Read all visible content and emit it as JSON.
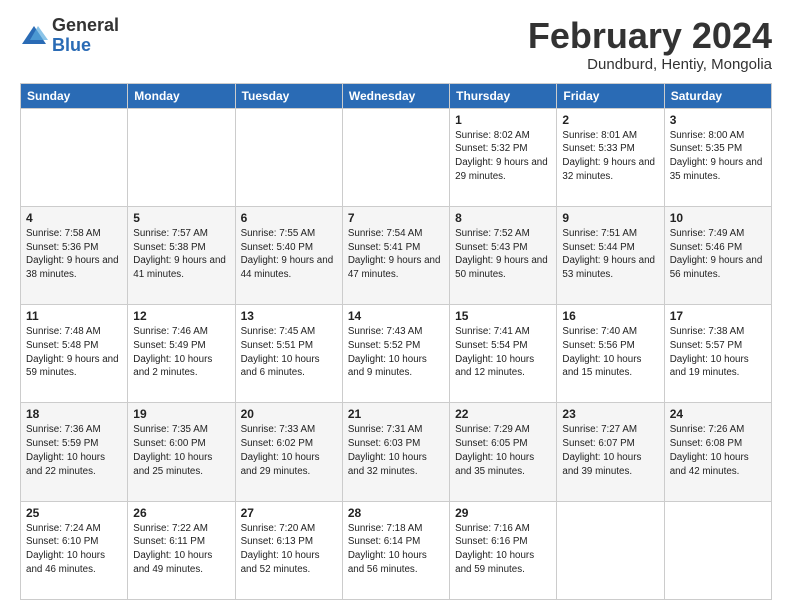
{
  "logo": {
    "general": "General",
    "blue": "Blue"
  },
  "title": "February 2024",
  "location": "Dundburd, Hentiy, Mongolia",
  "weekdays": [
    "Sunday",
    "Monday",
    "Tuesday",
    "Wednesday",
    "Thursday",
    "Friday",
    "Saturday"
  ],
  "weeks": [
    [
      {
        "day": "",
        "sunrise": "",
        "sunset": "",
        "daylight": ""
      },
      {
        "day": "",
        "sunrise": "",
        "sunset": "",
        "daylight": ""
      },
      {
        "day": "",
        "sunrise": "",
        "sunset": "",
        "daylight": ""
      },
      {
        "day": "",
        "sunrise": "",
        "sunset": "",
        "daylight": ""
      },
      {
        "day": "1",
        "sunrise": "Sunrise: 8:02 AM",
        "sunset": "Sunset: 5:32 PM",
        "daylight": "Daylight: 9 hours and 29 minutes."
      },
      {
        "day": "2",
        "sunrise": "Sunrise: 8:01 AM",
        "sunset": "Sunset: 5:33 PM",
        "daylight": "Daylight: 9 hours and 32 minutes."
      },
      {
        "day": "3",
        "sunrise": "Sunrise: 8:00 AM",
        "sunset": "Sunset: 5:35 PM",
        "daylight": "Daylight: 9 hours and 35 minutes."
      }
    ],
    [
      {
        "day": "4",
        "sunrise": "Sunrise: 7:58 AM",
        "sunset": "Sunset: 5:36 PM",
        "daylight": "Daylight: 9 hours and 38 minutes."
      },
      {
        "day": "5",
        "sunrise": "Sunrise: 7:57 AM",
        "sunset": "Sunset: 5:38 PM",
        "daylight": "Daylight: 9 hours and 41 minutes."
      },
      {
        "day": "6",
        "sunrise": "Sunrise: 7:55 AM",
        "sunset": "Sunset: 5:40 PM",
        "daylight": "Daylight: 9 hours and 44 minutes."
      },
      {
        "day": "7",
        "sunrise": "Sunrise: 7:54 AM",
        "sunset": "Sunset: 5:41 PM",
        "daylight": "Daylight: 9 hours and 47 minutes."
      },
      {
        "day": "8",
        "sunrise": "Sunrise: 7:52 AM",
        "sunset": "Sunset: 5:43 PM",
        "daylight": "Daylight: 9 hours and 50 minutes."
      },
      {
        "day": "9",
        "sunrise": "Sunrise: 7:51 AM",
        "sunset": "Sunset: 5:44 PM",
        "daylight": "Daylight: 9 hours and 53 minutes."
      },
      {
        "day": "10",
        "sunrise": "Sunrise: 7:49 AM",
        "sunset": "Sunset: 5:46 PM",
        "daylight": "Daylight: 9 hours and 56 minutes."
      }
    ],
    [
      {
        "day": "11",
        "sunrise": "Sunrise: 7:48 AM",
        "sunset": "Sunset: 5:48 PM",
        "daylight": "Daylight: 9 hours and 59 minutes."
      },
      {
        "day": "12",
        "sunrise": "Sunrise: 7:46 AM",
        "sunset": "Sunset: 5:49 PM",
        "daylight": "Daylight: 10 hours and 2 minutes."
      },
      {
        "day": "13",
        "sunrise": "Sunrise: 7:45 AM",
        "sunset": "Sunset: 5:51 PM",
        "daylight": "Daylight: 10 hours and 6 minutes."
      },
      {
        "day": "14",
        "sunrise": "Sunrise: 7:43 AM",
        "sunset": "Sunset: 5:52 PM",
        "daylight": "Daylight: 10 hours and 9 minutes."
      },
      {
        "day": "15",
        "sunrise": "Sunrise: 7:41 AM",
        "sunset": "Sunset: 5:54 PM",
        "daylight": "Daylight: 10 hours and 12 minutes."
      },
      {
        "day": "16",
        "sunrise": "Sunrise: 7:40 AM",
        "sunset": "Sunset: 5:56 PM",
        "daylight": "Daylight: 10 hours and 15 minutes."
      },
      {
        "day": "17",
        "sunrise": "Sunrise: 7:38 AM",
        "sunset": "Sunset: 5:57 PM",
        "daylight": "Daylight: 10 hours and 19 minutes."
      }
    ],
    [
      {
        "day": "18",
        "sunrise": "Sunrise: 7:36 AM",
        "sunset": "Sunset: 5:59 PM",
        "daylight": "Daylight: 10 hours and 22 minutes."
      },
      {
        "day": "19",
        "sunrise": "Sunrise: 7:35 AM",
        "sunset": "Sunset: 6:00 PM",
        "daylight": "Daylight: 10 hours and 25 minutes."
      },
      {
        "day": "20",
        "sunrise": "Sunrise: 7:33 AM",
        "sunset": "Sunset: 6:02 PM",
        "daylight": "Daylight: 10 hours and 29 minutes."
      },
      {
        "day": "21",
        "sunrise": "Sunrise: 7:31 AM",
        "sunset": "Sunset: 6:03 PM",
        "daylight": "Daylight: 10 hours and 32 minutes."
      },
      {
        "day": "22",
        "sunrise": "Sunrise: 7:29 AM",
        "sunset": "Sunset: 6:05 PM",
        "daylight": "Daylight: 10 hours and 35 minutes."
      },
      {
        "day": "23",
        "sunrise": "Sunrise: 7:27 AM",
        "sunset": "Sunset: 6:07 PM",
        "daylight": "Daylight: 10 hours and 39 minutes."
      },
      {
        "day": "24",
        "sunrise": "Sunrise: 7:26 AM",
        "sunset": "Sunset: 6:08 PM",
        "daylight": "Daylight: 10 hours and 42 minutes."
      }
    ],
    [
      {
        "day": "25",
        "sunrise": "Sunrise: 7:24 AM",
        "sunset": "Sunset: 6:10 PM",
        "daylight": "Daylight: 10 hours and 46 minutes."
      },
      {
        "day": "26",
        "sunrise": "Sunrise: 7:22 AM",
        "sunset": "Sunset: 6:11 PM",
        "daylight": "Daylight: 10 hours and 49 minutes."
      },
      {
        "day": "27",
        "sunrise": "Sunrise: 7:20 AM",
        "sunset": "Sunset: 6:13 PM",
        "daylight": "Daylight: 10 hours and 52 minutes."
      },
      {
        "day": "28",
        "sunrise": "Sunrise: 7:18 AM",
        "sunset": "Sunset: 6:14 PM",
        "daylight": "Daylight: 10 hours and 56 minutes."
      },
      {
        "day": "29",
        "sunrise": "Sunrise: 7:16 AM",
        "sunset": "Sunset: 6:16 PM",
        "daylight": "Daylight: 10 hours and 59 minutes."
      },
      {
        "day": "",
        "sunrise": "",
        "sunset": "",
        "daylight": ""
      },
      {
        "day": "",
        "sunrise": "",
        "sunset": "",
        "daylight": ""
      }
    ]
  ]
}
